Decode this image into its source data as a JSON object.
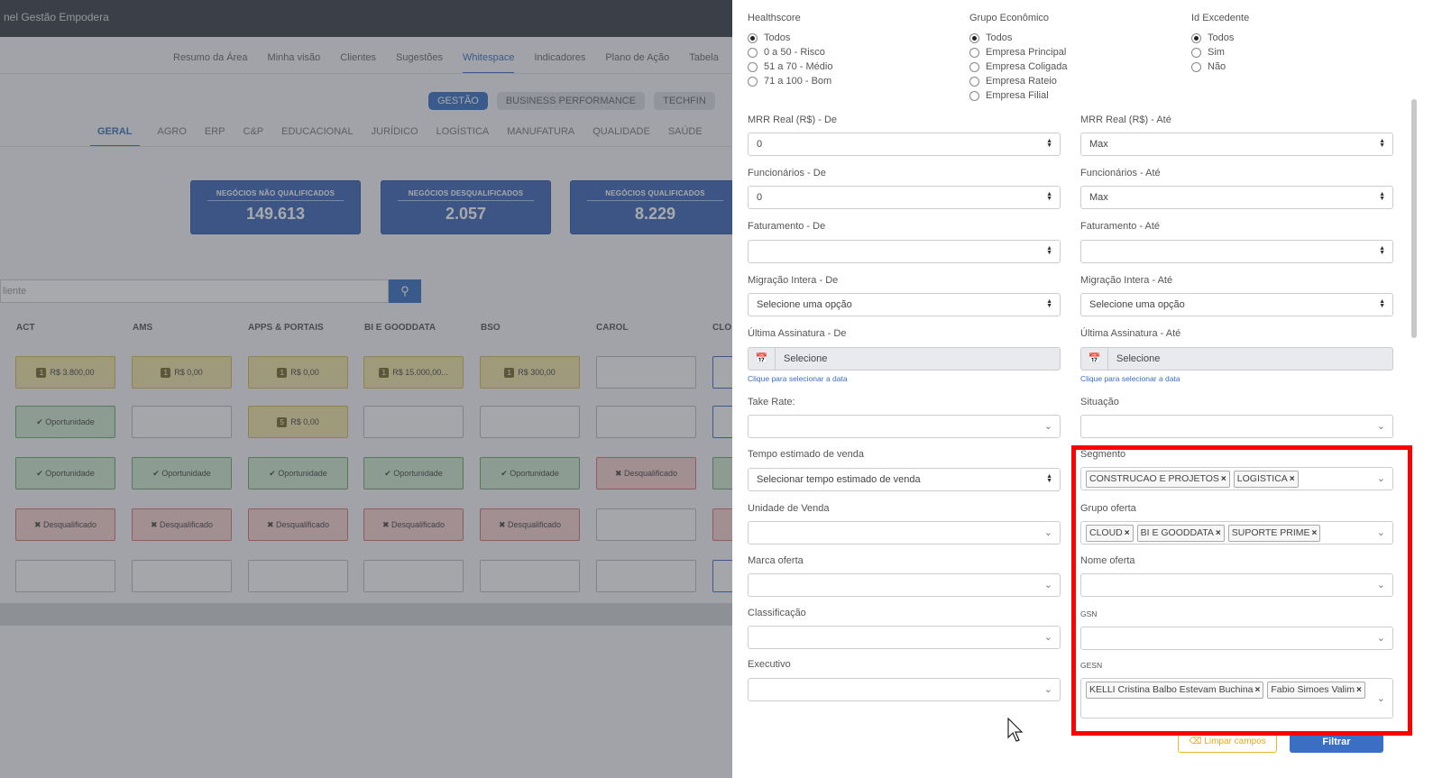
{
  "background": {
    "app_title": "nel Gestão Empodera",
    "nav": [
      "Resumo da Área",
      "Minha visão",
      "Clientes",
      "Sugestões",
      "Whitespace",
      "Indicadores",
      "Plano de Ação",
      "Tabela"
    ],
    "pills": [
      "GESTÃO",
      "BUSINESS PERFORMANCE",
      "TECHFIN"
    ],
    "segment_tabs": [
      "GERAL",
      "AGRO",
      "ERP",
      "C&P",
      "EDUCACIONAL",
      "JURÍDICO",
      "LOGÍSTICA",
      "MANUFATURA",
      "QUALIDADE",
      "SAÚDE"
    ],
    "kpis": [
      {
        "label": "NEGÓCIOS NÃO QUALIFICADOS",
        "value": "149.613"
      },
      {
        "label": "NEGÓCIOS DESQUALIFICADOS",
        "value": "2.057"
      },
      {
        "label": "NEGÓCIOS QUALIFICADOS",
        "value": "8.229"
      }
    ],
    "search_placeholder": "liente",
    "columns": [
      "ACT",
      "AMS",
      "APPS & PORTAIS",
      "BI E GOODDATA",
      "BSO",
      "CAROL",
      "CLO"
    ],
    "cells": {
      "r1": [
        "R$ 3.800,00",
        "R$ 0,00",
        "R$ 0,00",
        "R$ 15.000,00...",
        "R$ 300,00"
      ],
      "r2_first": "Oportunidade",
      "r2_third": "R$ 0,00",
      "opp": "Oportunidade",
      "dis": "Desqualificado"
    },
    "badges": {
      "one": "1",
      "five": "5"
    }
  },
  "panel": {
    "healthscore": {
      "label": "Healthscore",
      "options": [
        "Todos",
        "0 a 50 - Risco",
        "51 a 70 - Médio",
        "71 a 100 - Bom"
      ]
    },
    "grupo": {
      "label": "Grupo Econômico",
      "options": [
        "Todos",
        "Empresa Principal",
        "Empresa Coligada",
        "Empresa Rateio",
        "Empresa Filial"
      ]
    },
    "excedente": {
      "label": "Id Excedente",
      "options": [
        "Todos",
        "Sim",
        "Não"
      ]
    },
    "mrr_de": {
      "label": "MRR Real (R$) - De",
      "value": "0"
    },
    "mrr_ate": {
      "label": "MRR Real (R$) - Até",
      "value": "Max"
    },
    "func_de": {
      "label": "Funcionários - De",
      "value": "0"
    },
    "func_ate": {
      "label": "Funcionários - Até",
      "value": "Max"
    },
    "fat_de": {
      "label": "Faturamento - De",
      "value": ""
    },
    "fat_ate": {
      "label": "Faturamento - Até",
      "value": ""
    },
    "mig_de": {
      "label": "Migração Intera - De",
      "value": "Selecione uma opção"
    },
    "mig_ate": {
      "label": "Migração Intera - Até",
      "value": "Selecione uma opção"
    },
    "ult_de": {
      "label": "Última Assinatura - De",
      "placeholder": "Selecione",
      "hint": "Clique para selecionar a data"
    },
    "ult_ate": {
      "label": "Última Assinatura - Até",
      "placeholder": "Selecione",
      "hint": "Clique para selecionar a data"
    },
    "take_rate": {
      "label": "Take Rate:"
    },
    "situacao": {
      "label": "Situação"
    },
    "tempo": {
      "label": "Tempo estimado de venda",
      "value": "Selecionar tempo estimado de venda"
    },
    "segmento": {
      "label": "Segmento",
      "tags": [
        "CONSTRUCAO E PROJETOS",
        "LOGISTICA"
      ]
    },
    "unidade": {
      "label": "Unidade de Venda"
    },
    "grupo_oferta": {
      "label": "Grupo oferta",
      "tags": [
        "CLOUD",
        "BI E GOODDATA",
        "SUPORTE PRIME"
      ]
    },
    "marca": {
      "label": "Marca oferta"
    },
    "nome_oferta": {
      "label": "Nome oferta"
    },
    "classificacao": {
      "label": "Classificação"
    },
    "gsn": {
      "label": "GSN"
    },
    "executivo": {
      "label": "Executivo"
    },
    "gesn": {
      "label": "GESN",
      "tags": [
        "KELLI Cristina Balbo Estevam Buchina",
        "Fabio Simoes Valim"
      ]
    },
    "clear_label": "Limpar campos",
    "filter_label": "Filtrar"
  },
  "colors": {
    "accent": "#3a6fc4",
    "highlight": "#ff0000",
    "warn": "#e8a817"
  }
}
